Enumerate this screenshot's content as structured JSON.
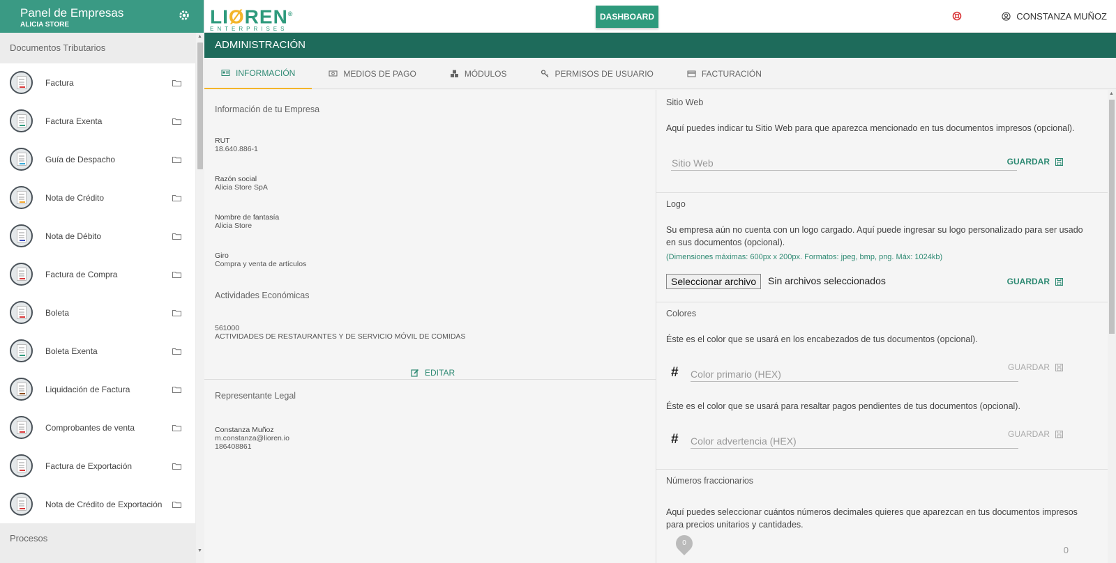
{
  "sidebar": {
    "title": "Panel de Empresas",
    "subtitle": "ALICIA STORE",
    "section1": "Documentos Tributarios",
    "items": [
      {
        "label": "Factura",
        "accent": "#d9383a"
      },
      {
        "label": "Factura Exenta",
        "accent": "#2e9a7c"
      },
      {
        "label": "Guía de Despacho",
        "accent": "#35a8d8"
      },
      {
        "label": "Nota de Crédito",
        "accent": "#f3a52a"
      },
      {
        "label": "Nota de Débito",
        "accent": "#3b4bbd"
      },
      {
        "label": "Factura de Compra",
        "accent": "#d9383a"
      },
      {
        "label": "Boleta",
        "accent": "#d9383a"
      },
      {
        "label": "Boleta Exenta",
        "accent": "#2e9a7c"
      },
      {
        "label": "Liquidación de Factura",
        "accent": "#8a4a1a"
      },
      {
        "label": "Comprobantes de venta",
        "accent": "#d9383a"
      },
      {
        "label": "Factura de Exportación",
        "accent": "#d9383a"
      },
      {
        "label": "Nota de Crédito de Exportación",
        "accent": "#d9383a"
      }
    ],
    "section2": "Procesos"
  },
  "topbar": {
    "logo_main_1": "LI",
    "logo_main_o": "Ø",
    "logo_main_2": "REN",
    "logo_reg": "®",
    "logo_sub": "ENTERPRISES",
    "dashboard_label": "DASHBOARD",
    "user_name": "CONSTANZA MUÑOZ"
  },
  "admin": {
    "title": "ADMINISTRACIÓN",
    "tabs": [
      {
        "label": "INFORMACIÓN",
        "icon": "id-card-icon"
      },
      {
        "label": "MEDIOS DE PAGO",
        "icon": "money-icon"
      },
      {
        "label": "MÓDULOS",
        "icon": "cubes-icon"
      },
      {
        "label": "PERMISOS DE USUARIO",
        "icon": "key-icon"
      },
      {
        "label": "FACTURACIÓN",
        "icon": "credit-card-icon"
      }
    ]
  },
  "info": {
    "section_title": "Información de tu Empresa",
    "rut_label": "RUT",
    "rut_value": "18.640.886-1",
    "razon_label": "Razón social",
    "razon_value": "Alicia Store SpA",
    "fantasia_label": "Nombre de fantasía",
    "fantasia_value": "Alicia Store",
    "giro_label": "Giro",
    "giro_value": "Compra y venta de artículos",
    "actividades_title": "Actividades Económicas",
    "actividad_code": "561000",
    "actividad_desc": "ACTIVIDADES DE RESTAURANTES Y DE SERVICIO MÓVIL DE COMIDAS",
    "edit_label": "EDITAR",
    "rep_title": "Representante Legal",
    "rep_name": "Constanza Muñoz",
    "rep_email": "m.constanza@lioren.io",
    "rep_id": "186408861"
  },
  "settings": {
    "web_title": "Sitio Web",
    "web_desc": "Aquí puedes indicar tu Sitio Web para que aparezca mencionado en tus documentos impresos (opcional).",
    "web_placeholder": "Sitio Web",
    "save_label": "GUARDAR",
    "logo_title": "Logo",
    "logo_desc": "Su empresa aún no cuenta con un logo cargado. Aquí puede ingresar su logo personalizado para ser usado en sus documentos (opcional).",
    "logo_dims": "(Dimensiones máximas: 600px x 200px. Formatos: jpeg, bmp, png. Máx: 1024kb)",
    "file_button": "Seleccionar archivo",
    "file_status": "Sin archivos seleccionados",
    "colors_title": "Colores",
    "primary_desc": "Éste es el color que se usará en los encabezados de tus documentos (opcional).",
    "hash": "#",
    "primary_placeholder": "Color primario (HEX)",
    "warning_desc": "Éste es el color que se usará para resaltar pagos pendientes de tus documentos (opcional).",
    "warning_placeholder": "Color advertencia (HEX)",
    "decimals_title": "Números fraccionarios",
    "decimals_desc": "Aquí puedes seleccionar cuántos números decimales quieres que aparezcan en tus documentos impresos para precios unitarios y cantidades.",
    "slider_value": "0",
    "slider_max_label": "0"
  },
  "colors": {
    "brand": "#2e9a7c",
    "header_dark": "#1e6b5b",
    "accent": "#f3b52a"
  }
}
